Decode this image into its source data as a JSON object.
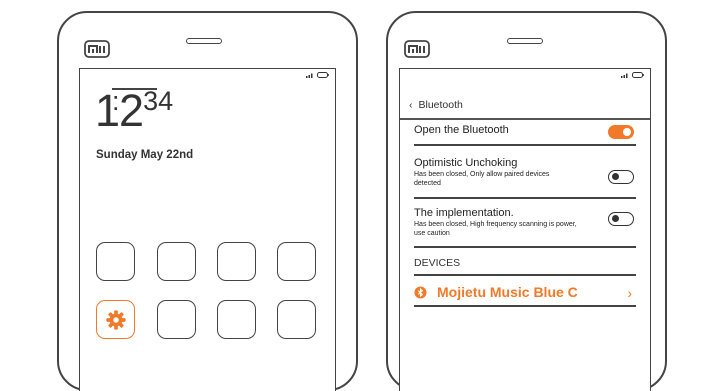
{
  "colors": {
    "accent": "#f07a2a",
    "outline": "#444444"
  },
  "left_phone": {
    "logo": "mi",
    "status": {
      "icons": [
        "signal-icon",
        "battery-icon"
      ]
    },
    "clock": {
      "hour": "12",
      "separator": ":",
      "minute": "34"
    },
    "date": "Sunday  May 22nd",
    "apps": [
      {
        "name": "app-icon",
        "icon": "blank"
      },
      {
        "name": "app-icon",
        "icon": "blank"
      },
      {
        "name": "app-icon",
        "icon": "blank"
      },
      {
        "name": "app-icon",
        "icon": "blank"
      },
      {
        "name": "settings-app",
        "icon": "gear-icon"
      },
      {
        "name": "app-icon",
        "icon": "blank"
      },
      {
        "name": "app-icon",
        "icon": "blank"
      },
      {
        "name": "app-icon",
        "icon": "blank"
      }
    ]
  },
  "right_phone": {
    "logo": "mi",
    "status": {
      "icons": [
        "signal-icon",
        "battery-icon"
      ]
    },
    "header": {
      "back_icon": "chevron-left-icon",
      "title": "Bluetooth"
    },
    "settings": [
      {
        "title": "Open the Bluetooth",
        "description": "",
        "enabled": true
      },
      {
        "title": "Optimistic Unchoking",
        "description": "Has been closed,   Only allow paired devices detected",
        "enabled": false
      },
      {
        "title": "The implementation.",
        "description": "Has been closed,   High frequency scanning is power, use caution",
        "enabled": false
      }
    ],
    "devices": {
      "label": "DEVICES",
      "items": [
        {
          "name": "Mojietu Music Blue C",
          "icon": "bluetooth-icon",
          "chevron": "›"
        }
      ]
    }
  }
}
